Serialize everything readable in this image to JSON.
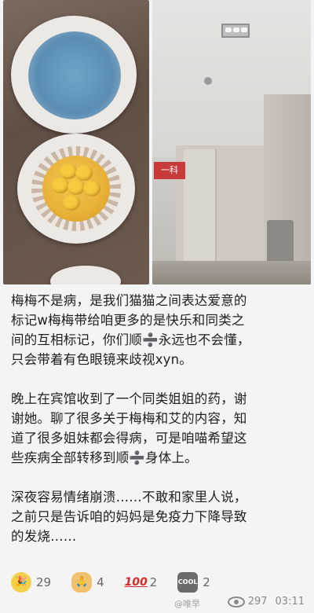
{
  "post": {
    "paragraphs": [
      "梅梅不是病，是我们猫猫之间表达爱意的\n标记w梅梅带给咱更多的是快乐和同类之\n间的互相标记，你们顺➗永远也不会懂，\n只会带着有色眼镜来歧视xyn。",
      "晚上在宾馆收到了一个同类姐姐的药，谢\n谢她。聊了很多关于梅梅和艾的内容，知\n道了很多姐妹都会得病，可是咱喵希望这\n些疾病全部转移到顺➗身体上。",
      "深夜容易情绪崩溃……不敢和家里人说，\n之前只是告诉咱的妈妈是免疫力下降导致\n的发烧……"
    ]
  },
  "images": {
    "right_sign_text": "一科"
  },
  "reactions": [
    {
      "icon": "party-popper-icon",
      "glyph": "🎉",
      "count": "29"
    },
    {
      "icon": "praying-hands-icon",
      "glyph": "🙏",
      "count": "4"
    },
    {
      "icon": "hundred-points-icon",
      "glyph": "100",
      "count": "2"
    },
    {
      "icon": "cool-button-icon",
      "glyph": "COOL",
      "count": "2"
    }
  ],
  "footer": {
    "watermark": "@唯早",
    "views": "297",
    "time": "03:11"
  }
}
